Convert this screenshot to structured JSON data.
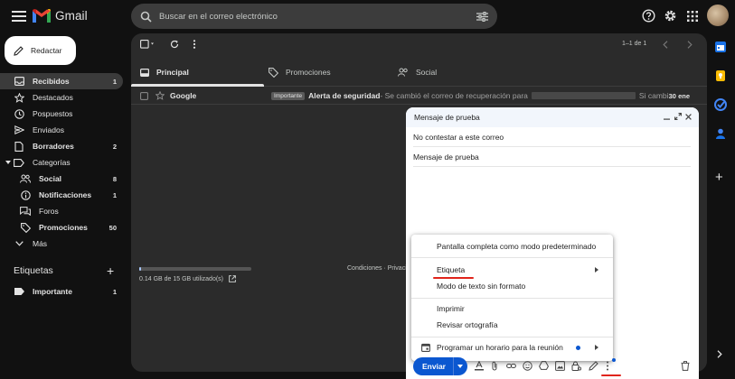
{
  "app": {
    "logo_text": "Gmail"
  },
  "search": {
    "placeholder": "Buscar en el correo electrónico"
  },
  "compose_button": {
    "label": "Redactar"
  },
  "sidebar": {
    "items": [
      {
        "label": "Recibidos",
        "count": "1"
      },
      {
        "label": "Destacados",
        "count": ""
      },
      {
        "label": "Pospuestos",
        "count": ""
      },
      {
        "label": "Enviados",
        "count": ""
      },
      {
        "label": "Borradores",
        "count": "2"
      },
      {
        "label": "Categorías",
        "count": ""
      },
      {
        "label": "Social",
        "count": "8"
      },
      {
        "label": "Notificaciones",
        "count": "1"
      },
      {
        "label": "Foros",
        "count": ""
      },
      {
        "label": "Promociones",
        "count": "50"
      },
      {
        "label": "Más",
        "count": ""
      }
    ],
    "labels_heading": "Etiquetas",
    "labels": [
      {
        "label": "Importante",
        "count": "1"
      }
    ]
  },
  "toolbar": {
    "pagination": "1–1 de 1"
  },
  "tabs": [
    {
      "label": "Principal"
    },
    {
      "label": "Promociones"
    },
    {
      "label": "Social"
    }
  ],
  "email_row": {
    "sender": "Google",
    "tag": "Importante",
    "subject": "Alerta de seguridad",
    "snippet_start": " - Se cambió el correo de recuperación para",
    "snippet_end": "Si cambi...",
    "date": "30 ene"
  },
  "storage": {
    "text": "0.14 GB de 15 GB utilizado(s)",
    "used_fraction": 0.01
  },
  "footer": {
    "links": "Condiciones · Privacid"
  },
  "compose_window": {
    "title": "Mensaje de prueba",
    "to": "No contestar a este correo",
    "subject": "Mensaje de prueba",
    "send_label": "Enviar"
  },
  "more_menu": {
    "items": [
      {
        "label": "Pantalla completa como modo predeterminado"
      },
      {
        "label": "Etiqueta"
      },
      {
        "label": "Modo de texto sin formato"
      },
      {
        "label": "Imprimir"
      },
      {
        "label": "Revisar ortografía"
      },
      {
        "label": "Programar un horario para la reunión"
      }
    ]
  },
  "colors": {
    "accent": "#0b57d0",
    "highlight": "#e0241b",
    "background": "#111111",
    "panel": "#2b2b2b"
  }
}
